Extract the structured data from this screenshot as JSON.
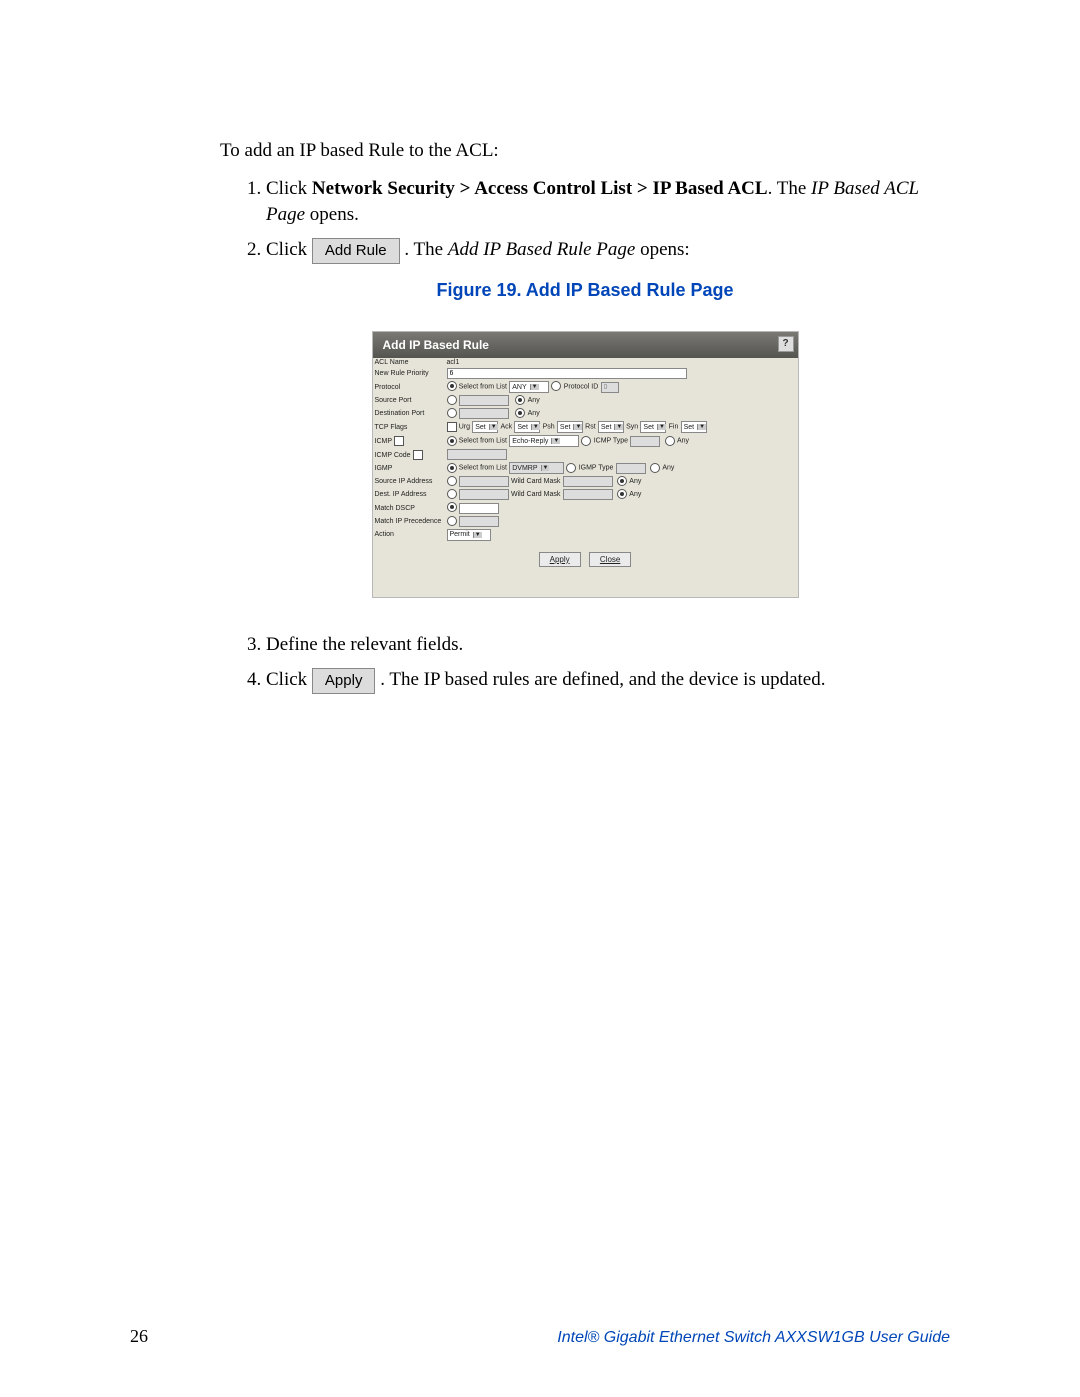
{
  "intro": "To add an IP based Rule to the ACL:",
  "steps": {
    "s1a": "Click ",
    "s1b": "Network Security > Access Control List > IP Based ACL",
    "s1c": ". The ",
    "s1d": "IP Based ACL Page",
    "s1e": " opens.",
    "s2a": "Click ",
    "s2btn": "Add Rule",
    "s2b": ". The ",
    "s2c": "Add IP Based Rule Page",
    "s2d": " opens:",
    "s3": "Define the relevant fields.",
    "s4a": "Click ",
    "s4btn": "Apply",
    "s4b": ". The IP based rules are defined, and the device is updated."
  },
  "figcap": "Figure 19. Add IP Based Rule Page",
  "shot": {
    "title": "Add IP Based Rule",
    "help": "?",
    "labels": {
      "acl_name": "ACL Name",
      "priority": "New Rule Priority",
      "protocol": "Protocol",
      "src_port": "Source Port",
      "dst_port": "Destination Port",
      "tcp_flags": "TCP Flags",
      "icmp": "ICMP",
      "icmp_code": "ICMP Code",
      "igmp": "IGMP",
      "src_ip": "Source IP Address",
      "dst_ip": "Dest. IP Address",
      "dscp": "Match DSCP",
      "ipprec": "Match IP Precedence",
      "action": "Action"
    },
    "values": {
      "acl_name": "acl1",
      "priority": "6",
      "select_from_list": "Select from List",
      "protocol_list": "ANY",
      "protocol_id": "Protocol ID",
      "protocol_id_val": "0",
      "any": "Any",
      "flags": {
        "urg": "Urg",
        "ack": "Ack",
        "psh": "Psh",
        "rst": "Rst",
        "syn": "Syn",
        "fin": "Fin"
      },
      "set": "Set",
      "icmp_list": "Echo-Reply",
      "icmp_type": "ICMP Type",
      "igmp_list": "DVMRP",
      "igmp_type": "IGMP Type",
      "wildcard": "Wild Card Mask",
      "action_val": "Permit",
      "apply": "Apply",
      "close": "Close"
    }
  },
  "footer": {
    "page": "26",
    "title": "Intel® Gigabit Ethernet Switch AXXSW1GB User Guide"
  }
}
